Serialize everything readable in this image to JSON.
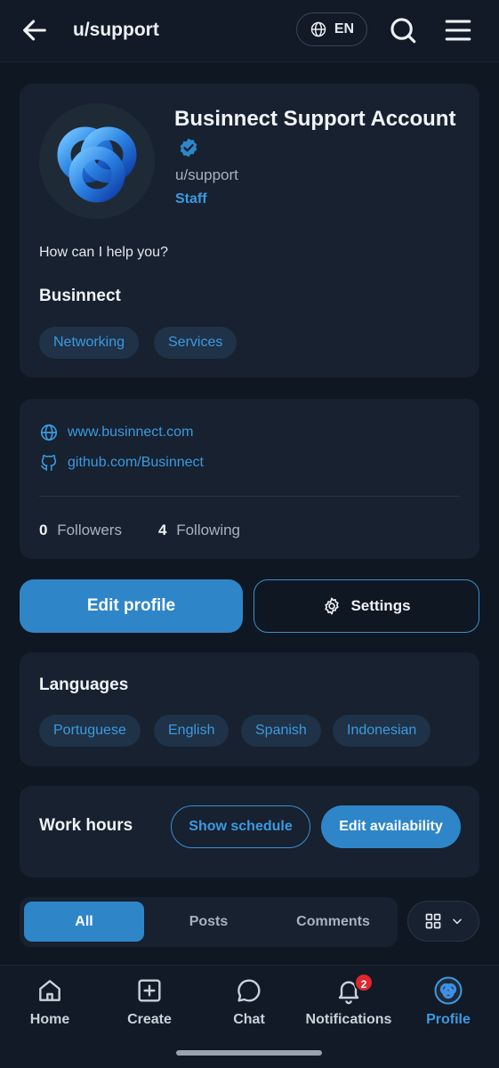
{
  "header": {
    "title": "u/support",
    "language": "EN"
  },
  "profile": {
    "name": "Businnect Support Account",
    "handle": "u/support",
    "role": "Staff",
    "bio": "How can I help you?",
    "company": "Businnect",
    "tags": [
      "Networking",
      "Services"
    ]
  },
  "links": {
    "website": "www.businnect.com",
    "github": "github.com/Businnect"
  },
  "stats": {
    "followers_count": "0",
    "followers_label": "Followers",
    "following_count": "4",
    "following_label": "Following"
  },
  "actions": {
    "edit_profile": "Edit profile",
    "settings": "Settings"
  },
  "languages": {
    "title": "Languages",
    "items": [
      "Portuguese",
      "English",
      "Spanish",
      "Indonesian"
    ]
  },
  "work_hours": {
    "title": "Work hours",
    "show_schedule": "Show schedule",
    "edit_availability": "Edit availability"
  },
  "content_tabs": {
    "all": "All",
    "posts": "Posts",
    "comments": "Comments",
    "active": "All"
  },
  "bottom_nav": {
    "home": "Home",
    "create": "Create",
    "chat": "Chat",
    "notifications": "Notifications",
    "notifications_badge": "2",
    "profile": "Profile",
    "active": "Profile"
  },
  "colors": {
    "accent": "#2e86c8",
    "link": "#3b9ae1",
    "background": "#0f1722",
    "card": "#172130",
    "badge": "#e0262f"
  }
}
